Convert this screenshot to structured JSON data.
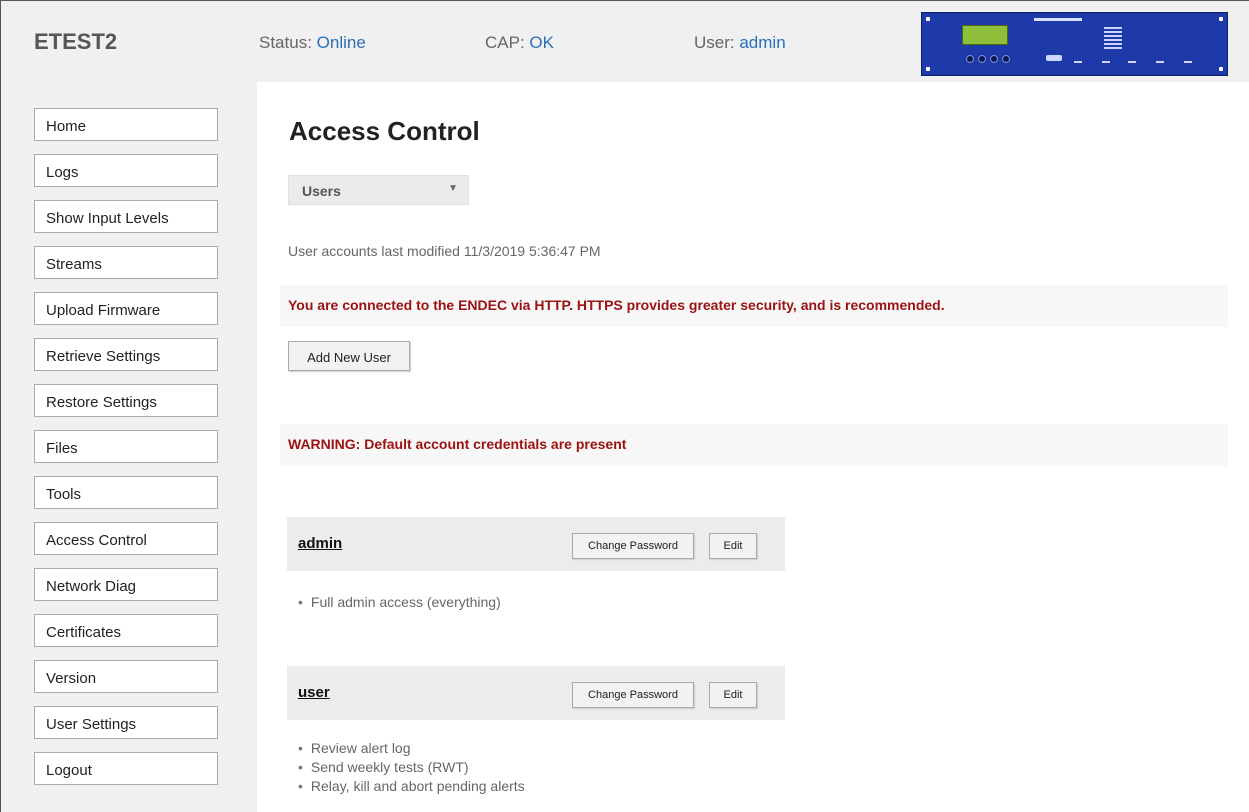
{
  "header": {
    "site_name": "ETEST2",
    "status": {
      "label": "Status: ",
      "value": "Online"
    },
    "cap": {
      "label": "CAP: ",
      "value": "OK"
    },
    "user": {
      "label": "User: ",
      "value": "admin"
    },
    "accent_color": "#2a6fb8"
  },
  "nav": [
    "Home",
    "Logs",
    "Show Input Levels",
    "Streams",
    "Upload Firmware",
    "Retrieve Settings",
    "Restore Settings",
    "Files",
    "Tools",
    "Access Control",
    "Network Diag",
    "Certificates",
    "Version",
    "User Settings",
    "Logout"
  ],
  "main": {
    "title": "Access Control",
    "view_select": {
      "value": "Users",
      "caret_icon": "triangle-down"
    },
    "modified_text": "User accounts last modified 11/3/2019 5:36:47 PM",
    "https_notice": "You are connected to the ENDEC via HTTP. HTTPS provides greater security, and is recommended.",
    "add_user_label": "Add New User",
    "warning": "WARNING: Default account credentials are present",
    "warning_color": "#9a1212",
    "users": [
      {
        "name": "admin",
        "change_password_label": "Change Password",
        "edit_label": "Edit",
        "permissions": [
          "Full admin access (everything)"
        ]
      },
      {
        "name": "user",
        "change_password_label": "Change Password",
        "edit_label": "Edit",
        "permissions": [
          "Review alert log",
          "Send weekly tests (RWT)",
          "Relay, kill and abort pending alerts"
        ]
      }
    ]
  }
}
